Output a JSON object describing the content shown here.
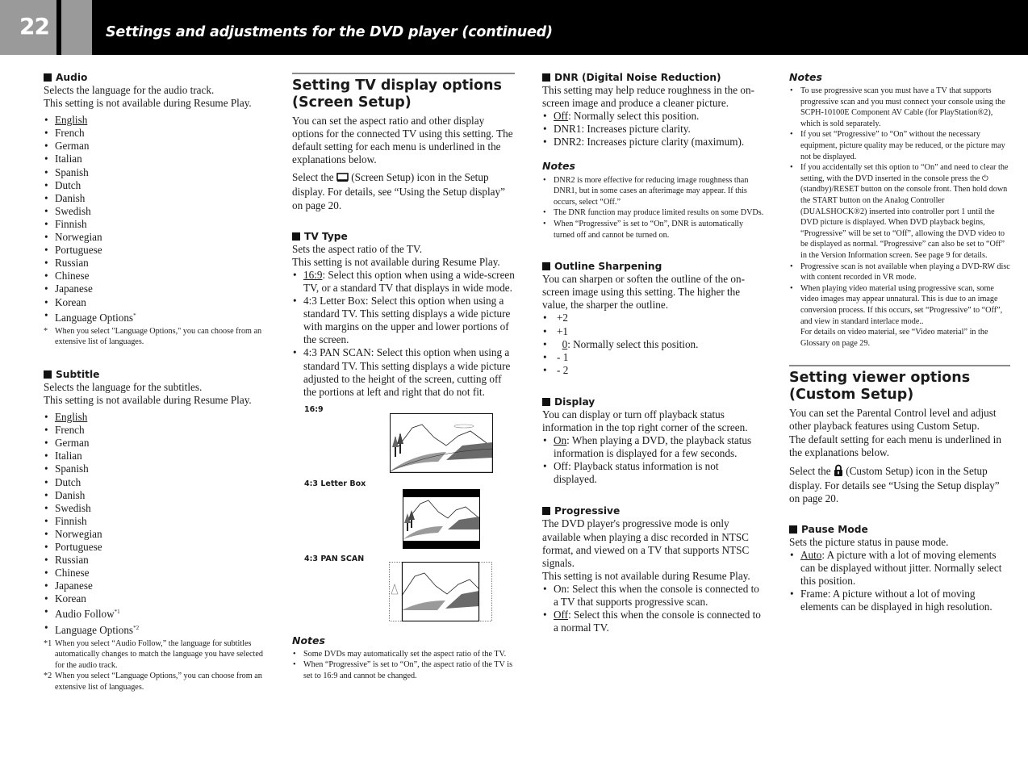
{
  "header": {
    "page_number": "22",
    "title": "Settings and adjustments for the DVD player (continued)"
  },
  "audio": {
    "heading": "Audio",
    "desc1": "Selects the language for the audio track.",
    "desc2": "This setting is not available during Resume Play.",
    "options": [
      "English",
      "French",
      "German",
      "Italian",
      "Spanish",
      "Dutch",
      "Danish",
      "Swedish",
      "Finnish",
      "Norwegian",
      "Portuguese",
      "Russian",
      "Chinese",
      "Japanese",
      "Korean"
    ],
    "default_option": "English",
    "last_option": "Language Options",
    "last_option_mark": "*",
    "footnote_mark": "*",
    "footnote": "When you select \"Language Options,\" you can choose from an extensive list of languages."
  },
  "subtitle": {
    "heading": "Subtitle",
    "desc1": "Selects the language for the subtitles.",
    "desc2": "This setting is not available during Resume Play.",
    "options": [
      "English",
      "French",
      "German",
      "Italian",
      "Spanish",
      "Dutch",
      "Danish",
      "Swedish",
      "Finnish",
      "Norwegian",
      "Portuguese",
      "Russian",
      "Chinese",
      "Japanese",
      "Korean"
    ],
    "audio_follow": "Audio Follow",
    "audio_follow_mark": "*1",
    "language_options": "Language Options",
    "language_options_mark": "*2",
    "footnotes": [
      {
        "mark": "*1",
        "text": "When you select “Audio Follow,” the language for subtitles automatically changes to match the language you have selected for the audio track."
      },
      {
        "mark": "*2",
        "text": "When you select “Language Options,” you can choose from an extensive list of languages."
      }
    ]
  },
  "screen_setup": {
    "heading": "Setting TV display options (Screen Setup)",
    "intro": "You can set the aspect ratio and other display options for the connected TV using this setting. The default setting for each menu is underlined in the explanations below.",
    "select_pre": "Select the",
    "select_icon": "screen-setup-icon",
    "select_post": "(Screen Setup) icon in the Setup display. For details, see “Using the Setup display” on page 20."
  },
  "tv_type": {
    "heading": "TV Type",
    "desc1": "Sets the aspect ratio of the TV.",
    "desc2": "This setting is not available during Resume Play.",
    "options": [
      {
        "label": "16:9",
        "underlined": true,
        "text": ": Select this option when using a wide-screen TV, or a standard TV that displays in wide mode."
      },
      {
        "label": "4:3 Letter Box",
        "underlined": false,
        "text": ": Select this option when using a standard TV. This setting displays a wide picture with margins on the upper and lower portions of the screen."
      },
      {
        "label": "4:3 PAN SCAN",
        "underlined": false,
        "text": ": Select this option when using a standard TV. This setting displays a wide picture adjusted to the height of the screen, cutting off the portions at left and right that do not fit."
      }
    ],
    "figures": [
      "16:9",
      "4:3 Letter Box",
      "4:3 PAN SCAN"
    ],
    "notes_heading": "Notes",
    "notes": [
      "Some DVDs may automatically set the aspect ratio of the TV.",
      "When “Progressive” is set to “On”, the aspect ratio of the TV is set to 16:9 and cannot be changed."
    ]
  },
  "dnr": {
    "heading": "DNR (Digital Noise Reduction)",
    "desc": "This setting may help reduce roughness in the on-screen image and produce a cleaner picture.",
    "options": [
      {
        "label": "Off",
        "underlined": true,
        "text": ": Normally select this position."
      },
      {
        "label": "DNR1",
        "underlined": false,
        "text": ": Increases picture clarity."
      },
      {
        "label": "DNR2",
        "underlined": false,
        "text": ": Increases picture clarity (maximum)."
      }
    ],
    "notes_heading": "Notes",
    "notes": [
      "DNR2 is more effective for reducing image roughness than DNR1, but in some cases an afterimage may appear. If this occurs, select “Off.”",
      "The DNR function may produce limited results on some DVDs.",
      "When “Progressive” is set to “On”, DNR is automatically turned off and cannot be turned on."
    ]
  },
  "outline": {
    "heading": "Outline Sharpening",
    "desc": "You can sharpen or soften the outline of the on-screen image using this setting. The higher the value, the sharper the outline.",
    "opt_p2": "+2",
    "opt_p1": "+1",
    "opt_0": "0",
    "opt_0_text": ": Normally select this position.",
    "opt_m1": "- 1",
    "opt_m2": "- 2"
  },
  "display": {
    "heading": "Display",
    "desc": "You can display or turn off playback status information in the top right corner of the screen.",
    "options": [
      {
        "label": "On",
        "underlined": true,
        "text": ": When playing a DVD, the playback status information is displayed for a few seconds."
      },
      {
        "label": "Off",
        "underlined": false,
        "text": ": Playback status information is not displayed."
      }
    ]
  },
  "progressive": {
    "heading": "Progressive",
    "desc1": "The DVD player's progressive mode is only available when playing a disc recorded in NTSC format, and viewed on a TV that supports NTSC signals.",
    "desc2": "This setting is not available during Resume Play.",
    "options": [
      {
        "label": "On",
        "underlined": false,
        "text": ": Select this when the console is connected to a TV that supports progressive scan."
      },
      {
        "label": "Off",
        "underlined": true,
        "text": ": Select this when the console is connected to a normal TV."
      }
    ],
    "notes_heading": "Notes",
    "notes": [
      "To use progressive scan you must have a TV that supports progressive scan and you must connect your console using the SCPH-10100E Component AV Cable (for PlayStation®2), which is sold separately.",
      "If you set “Progressive” to “On” without the necessary equipment, picture quality may be reduced, or the picture may not be displayed.",
      "If you accidentally set this option to “On” and need to clear the setting, with the DVD inserted in the console press the ⏻ (standby)/RESET button on the console front. Then  hold down the START button on the Analog Controller (DUALSHOCK®2) inserted into controller port 1 until the DVD picture is displayed. When DVD playback begins, “Progressive” will be set to “Off”, allowing the DVD video to be displayed as normal. “Progressive” can also be set to “Off” in the Version Information screen. See page 9 for details.",
      "Progressive scan is not available when playing a DVD-RW disc with content recorded in VR mode.",
      "When playing video material using progressive scan, some video images may appear unnatural. This is due to an image conversion process. If this occurs, set “Progressive” to “Off”, and view in standard interlace mode.."
    ],
    "notes_extra": "For details on video material, see “Video material” in the Glossary on page 29."
  },
  "custom_setup": {
    "heading": "Setting viewer options (Custom Setup)",
    "intro1": "You can set the Parental Control level and adjust other playback features using Custom Setup.",
    "intro2": "The default setting for each menu is underlined in the explanations below.",
    "select_pre": "Select the",
    "select_icon": "lock-icon",
    "select_post": "(Custom Setup) icon in the Setup display. For details see “Using the Setup display” on page 20."
  },
  "pause_mode": {
    "heading": "Pause Mode",
    "desc": "Sets the picture status in pause mode.",
    "options": [
      {
        "label": "Auto",
        "underlined": true,
        "text": ": A picture with a lot of moving elements can be displayed without jitter. Normally select this position."
      },
      {
        "label": "Frame",
        "underlined": false,
        "text": ": A picture without a lot of moving elements can be displayed in high resolution."
      }
    ]
  }
}
